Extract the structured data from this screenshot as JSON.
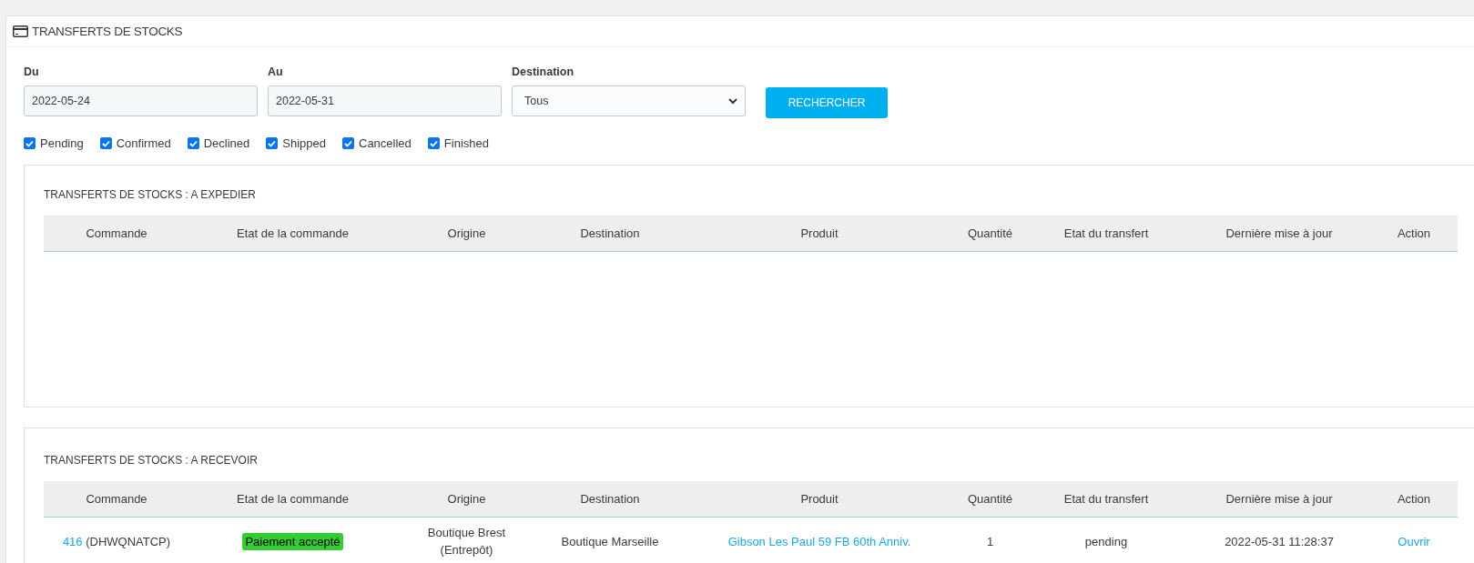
{
  "panel": {
    "title": "TRANSFERTS DE STOCKS"
  },
  "filters": {
    "from": {
      "label": "Du",
      "value": "2022-05-24"
    },
    "to": {
      "label": "Au",
      "value": "2022-05-31"
    },
    "destination": {
      "label": "Destination",
      "value": "Tous"
    },
    "search_button": "RECHERCHER",
    "statuses": [
      {
        "label": "Pending",
        "checked": true
      },
      {
        "label": "Confirmed",
        "checked": true
      },
      {
        "label": "Declined",
        "checked": true
      },
      {
        "label": "Shipped",
        "checked": true
      },
      {
        "label": "Cancelled",
        "checked": true
      },
      {
        "label": "Finished",
        "checked": true
      }
    ]
  },
  "sections": [
    {
      "title": "TRANSFERTS DE STOCKS : A EXPEDIER",
      "columns": [
        "Commande",
        "Etat de la commande",
        "Origine",
        "Destination",
        "Produit",
        "Quantité",
        "Etat du transfert",
        "Dernière mise à jour",
        "Action"
      ]
    },
    {
      "title": "TRANSFERTS DE STOCKS : A RECEVOIR",
      "columns": [
        "Commande",
        "Etat de la commande",
        "Origine",
        "Destination",
        "Produit",
        "Quantité",
        "Etat du transfert",
        "Dernière mise à jour",
        "Action"
      ],
      "rows": [
        {
          "order_id": "416",
          "order_ref": "(DHWQNATCP)",
          "order_status": {
            "label": "Paiement accepté",
            "color": "#32cd32"
          },
          "origin": [
            "Boutique Brest",
            "(Entrepôt)"
          ],
          "destination": "Boutique Marseille",
          "product": "Gibson Les Paul 59 FB 60th Anniv.",
          "quantity": "1",
          "transfer_status": "pending",
          "updated": "2022-05-31 11:28:37",
          "action": "Ouvrir"
        }
      ]
    }
  ]
}
